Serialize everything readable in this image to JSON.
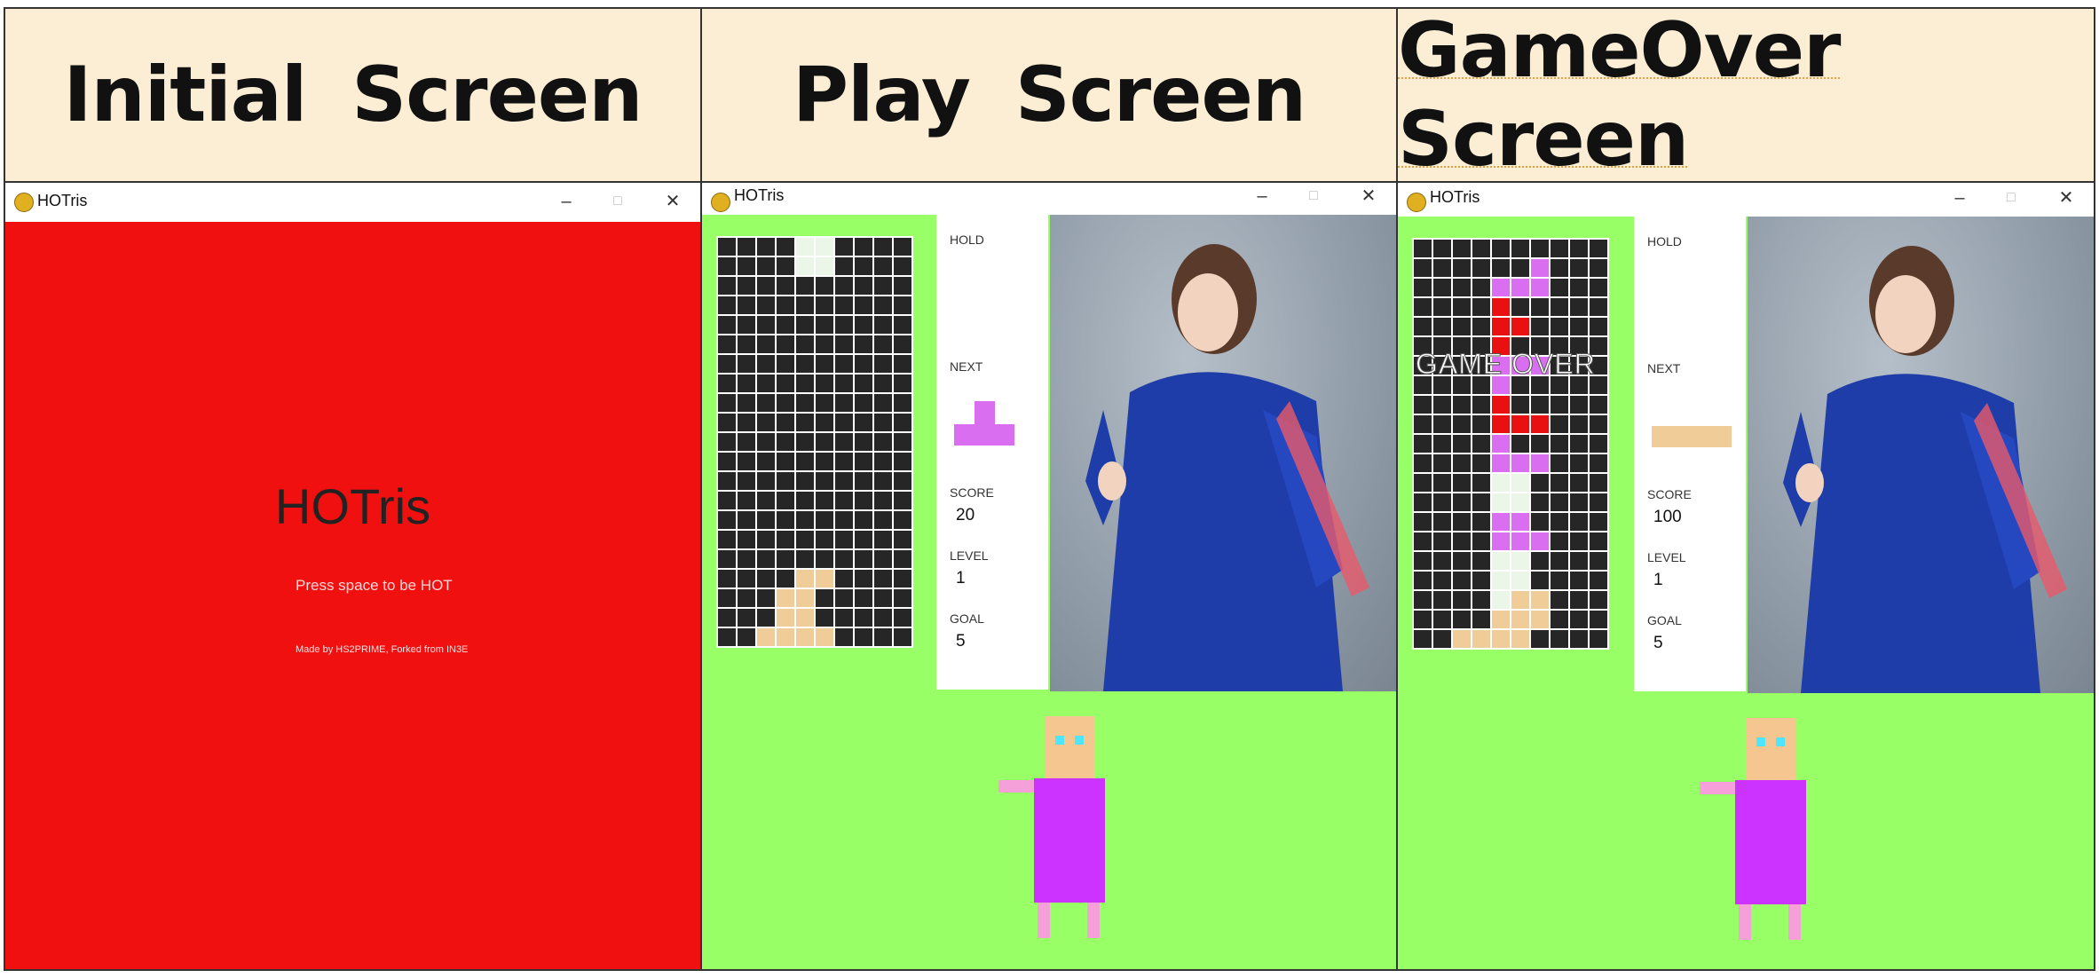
{
  "panels": [
    {
      "header": "Initial  Screen"
    },
    {
      "header": "Play  Screen"
    },
    {
      "header": "GameOver  Screen"
    }
  ],
  "window": {
    "title": "HOTris",
    "minimize": "–",
    "maximize": "□",
    "close": "✕"
  },
  "initial": {
    "title": "HOTris",
    "prompt": "Press space to be HOT",
    "credit": "Made by HS2PRIME, Forked from IN3E",
    "background": "#f01010"
  },
  "play": {
    "hold_label": "HOLD",
    "next_label": "NEXT",
    "score_label": "SCORE",
    "score": "20",
    "level_label": "LEVEL",
    "level": "1",
    "goal_label": "GOAL",
    "goal": "5",
    "next_piece": "T",
    "board": [
      "....WW....",
      "....WW....",
      "..........",
      "..........",
      "..........",
      "..........",
      "..........",
      "..........",
      "..........",
      "..........",
      "..........",
      "..........",
      "..........",
      "..........",
      "..........",
      "..........",
      "..........",
      "....OO....",
      "...OO.....",
      "...OO.....",
      "..OOOO...."
    ]
  },
  "gameover": {
    "overlay_text": "GAME OVER",
    "hold_label": "HOLD",
    "next_label": "NEXT",
    "score_label": "SCORE",
    "score": "100",
    "level_label": "LEVEL",
    "level": "1",
    "goal_label": "GOAL",
    "goal": "5",
    "next_piece": "I",
    "board": [
      "..........",
      "......P...",
      "....PPP...",
      "....R.....",
      "....RR....",
      "....R.....",
      "....PPP...",
      "....P.....",
      "....R.....",
      "....RRR...",
      "....P.....",
      "....PPP...",
      "....WW....",
      "....WW....",
      "....PP....",
      "....PPP...",
      "....WW....",
      "....WW....",
      "....WOO...",
      "....OOO...",
      "..OOOO...."
    ]
  },
  "colors": {
    "game_bg": "#99ff66",
    "cell_empty": "#262626",
    "P": "#d96ff0",
    "R": "#e81010",
    "W": "#ebf5e8",
    "O": "#f0cc98",
    "char_skin": "#f5c690",
    "char_body": "#cc33ff",
    "char_arm": "#f5a0d8",
    "char_eye": "#4ee6ff"
  }
}
